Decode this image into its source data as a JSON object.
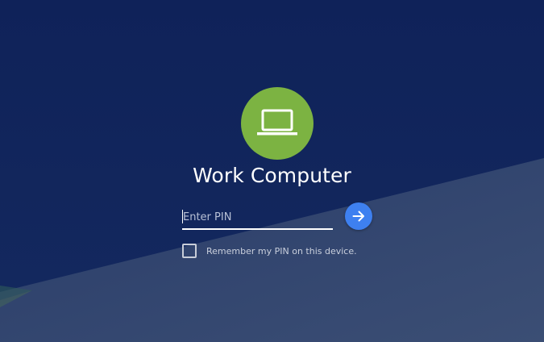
{
  "user": {
    "name": "Work Computer",
    "avatar_icon": "laptop-icon",
    "avatar_color": "#7cb342"
  },
  "pin": {
    "placeholder": "Enter PIN",
    "value": "",
    "submit_icon": "arrow-right-icon",
    "submit_color": "#3e80f0"
  },
  "remember": {
    "label": "Remember my PIN on this device.",
    "checked": false
  },
  "background": {
    "primary": "#0f2259",
    "secondary": "#33466e"
  }
}
